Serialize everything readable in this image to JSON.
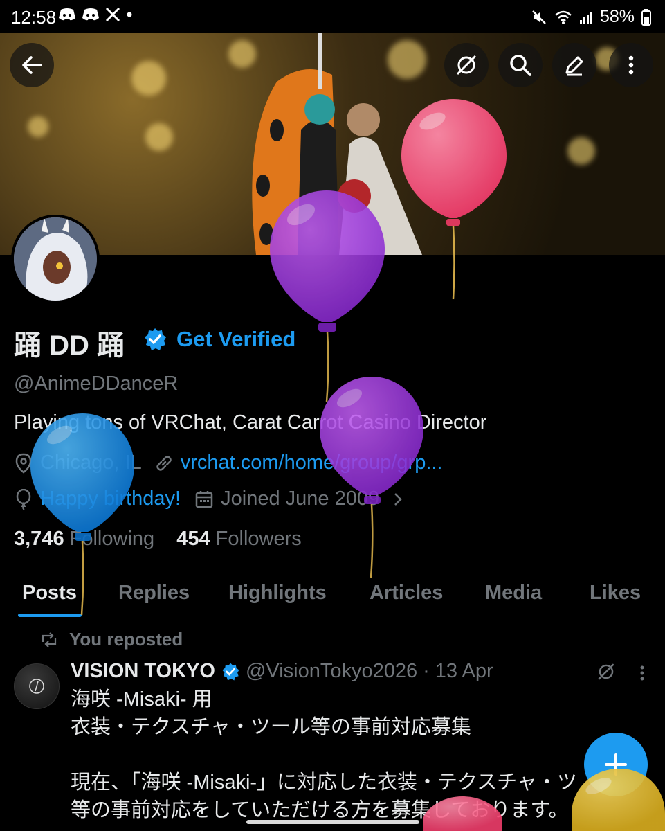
{
  "status": {
    "time": "12:58",
    "battery": "58%"
  },
  "header": {
    "back_icon": "arrow-left-icon",
    "actions": [
      "grok-icon",
      "search-icon",
      "edit-icon",
      "more-vertical-icon"
    ]
  },
  "profile": {
    "display_name": "踊 DD 踊",
    "get_verified": "Get Verified",
    "handle": "@AnimeDDanceR",
    "bio": "Playing tons of VRChat, Carat Carrot Casino Director",
    "location": "Chicago, IL",
    "website": "vrchat.com/home/group/grp...",
    "birthday": "Happy birthday!",
    "joined": "Joined June 2009",
    "following_count": "3,746",
    "following_label": "Following",
    "followers_count": "454",
    "followers_label": "Followers"
  },
  "tabs": [
    "Posts",
    "Replies",
    "Highlights",
    "Articles",
    "Media",
    "Likes"
  ],
  "post": {
    "repost_label": "You reposted",
    "author": "VISION TOKYO",
    "handle": "@VisionTokyo2026",
    "separator": "·",
    "date": "13 Apr",
    "lines": [
      "海咲 -Misaki- 用",
      "衣装・テクスチャ・ツール等の事前対応募集",
      "",
      "現在、「海咲 -Misaki-」に対応した衣装・テクスチャ・ツ",
      "等の事前対応をしていただける方を募集しております。"
    ]
  },
  "fab": {
    "icon": "plus-icon"
  },
  "colors": {
    "accent": "#1d9bf0",
    "muted": "#71767b",
    "text": "#e7e9ea"
  }
}
